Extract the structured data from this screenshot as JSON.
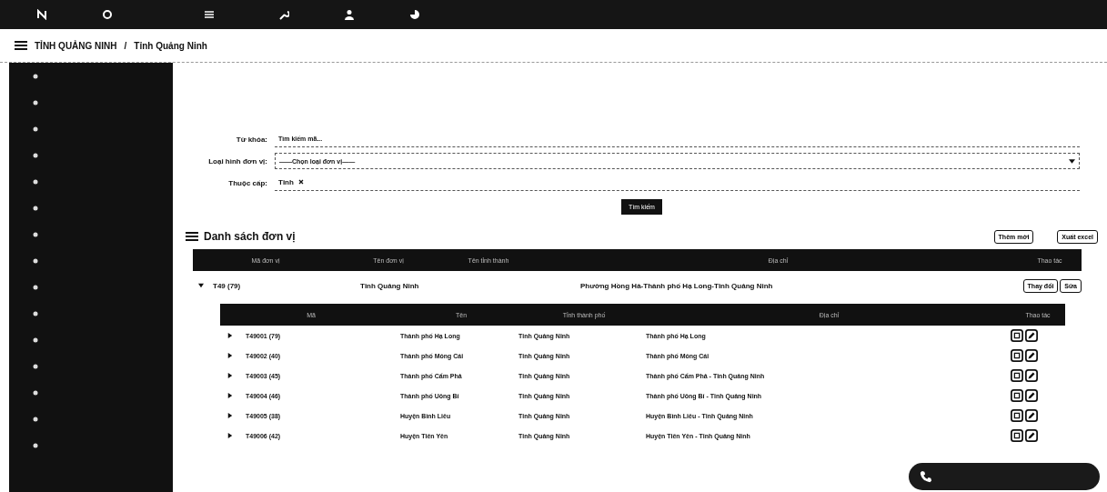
{
  "breadcrumb": {
    "parent": "TỈNH QUẢNG NINH",
    "separator": "/",
    "current": "Tỉnh Quảng Ninh"
  },
  "filters": [
    {
      "kind": "text",
      "label": "Từ khóa:",
      "placeholder": "Tìm kiếm mã..."
    },
    {
      "kind": "select",
      "label": "Loại hình đơn vị:",
      "placeholder": "——Chọn loại đơn vị——"
    },
    {
      "kind": "tags",
      "label": "Thuộc cấp:",
      "tags": [
        "Tỉnh"
      ]
    }
  ],
  "search_button": "Tìm kiếm",
  "list": {
    "title": "Danh sách đơn vị",
    "buttons": [
      "Thêm mới",
      "Xuất excel"
    ],
    "columns": [
      "Mã đơn vị",
      "Tên đơn vị",
      "Tên tỉnh thành",
      "Địa chỉ",
      "Thao tác"
    ],
    "rows": [
      {
        "code": "T49 (79)",
        "name": "Tỉnh Quảng Ninh",
        "address": "Phường Hồng Hà-Thành phố Hạ Long-Tỉnh Quảng Ninh",
        "expanded": true,
        "actions": [
          "Thay đổi",
          "Sửa"
        ],
        "child_columns": [
          "Mã",
          "Tên",
          "Tỉnh thành phố",
          "Địa chỉ",
          "Thao tác"
        ],
        "children": [
          {
            "code": "T49001 (79)",
            "name": "Thành phố Hạ Long",
            "province": "Tỉnh Quảng Ninh",
            "address": "Thành phố Hạ Long",
            "expanded": false
          },
          {
            "code": "T49002 (40)",
            "name": "Thành phố Móng Cái",
            "province": "Tỉnh Quảng Ninh",
            "address": "Thành phố Móng Cái",
            "expanded": false
          },
          {
            "code": "T49003 (45)",
            "name": "Thành phố Cẩm Phả",
            "province": "Tỉnh Quảng Ninh",
            "address": "Thành phố Cẩm Phả - Tỉnh Quảng Ninh",
            "expanded": false
          },
          {
            "code": "T49004 (46)",
            "name": "Thành phố Uông Bí",
            "province": "Tỉnh Quảng Ninh",
            "address": "Thành phố Uông Bí - Tỉnh Quảng Ninh",
            "expanded": false
          },
          {
            "code": "T49005 (38)",
            "name": "Huyện Bình Liêu",
            "province": "Tỉnh Quảng Ninh",
            "address": "Huyện Bình Liêu - Tỉnh Quảng Ninh",
            "expanded": false
          },
          {
            "code": "T49006 (42)",
            "name": "Huyện Tiên Yên",
            "province": "Tỉnh Quảng Ninh",
            "address": "Huyện Tiên Yên - Tỉnh Quảng Ninh",
            "expanded": false
          }
        ]
      }
    ]
  }
}
